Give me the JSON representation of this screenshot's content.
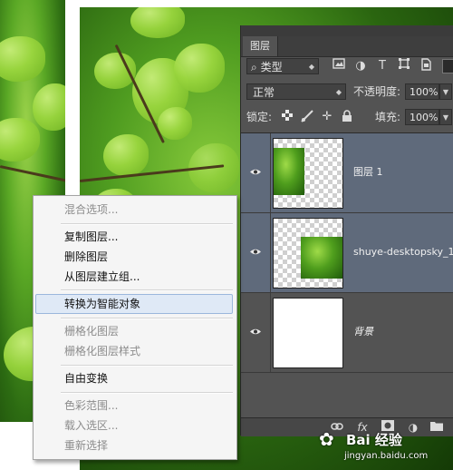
{
  "panel": {
    "tab_label": "图层",
    "filter_value": "类型",
    "filter_icons": [
      "image-filter-icon",
      "adjustment-filter-icon",
      "type-filter-icon",
      "shape-filter-icon",
      "smart-object-filter-icon"
    ],
    "blend_mode": "正常",
    "opacity_label": "不透明度:",
    "opacity_value": "100%",
    "lock_label": "锁定:",
    "fill_label": "填充:",
    "fill_value": "100%",
    "bottom_icons": [
      "link-icon",
      "fx-icon",
      "mask-icon",
      "adjustment-icon",
      "folder-icon"
    ]
  },
  "layers": [
    {
      "name": "图层 1",
      "selected": true,
      "visible": true
    },
    {
      "name": "shuye-desktopsky_1",
      "selected": true,
      "visible": true
    },
    {
      "name": "背景",
      "selected": false,
      "visible": true
    }
  ],
  "context_menu": {
    "items": [
      {
        "label": "混合选项...",
        "disabled": true
      },
      {
        "label": "复制图层...",
        "disabled": false
      },
      {
        "label": "删除图层",
        "disabled": false
      },
      {
        "label": "从图层建立组...",
        "disabled": false
      },
      {
        "label": "转换为智能对象",
        "disabled": false,
        "highlighted": true
      },
      {
        "label": "栅格化图层",
        "disabled": true
      },
      {
        "label": "栅格化图层样式",
        "disabled": true
      },
      {
        "label": "自由变换",
        "disabled": false
      },
      {
        "label": "色彩范围...",
        "disabled": true
      },
      {
        "label": "载入选区...",
        "disabled": true
      },
      {
        "label": "重新选择",
        "disabled": true
      }
    ]
  },
  "watermark": {
    "text": "Bai 经验",
    "url": "jingyan.baidu.com"
  },
  "colors": {
    "panel_bg": "#535353",
    "selected_layer_bg": "#5f6a7b",
    "menu_highlight": "#dfe9f6"
  }
}
